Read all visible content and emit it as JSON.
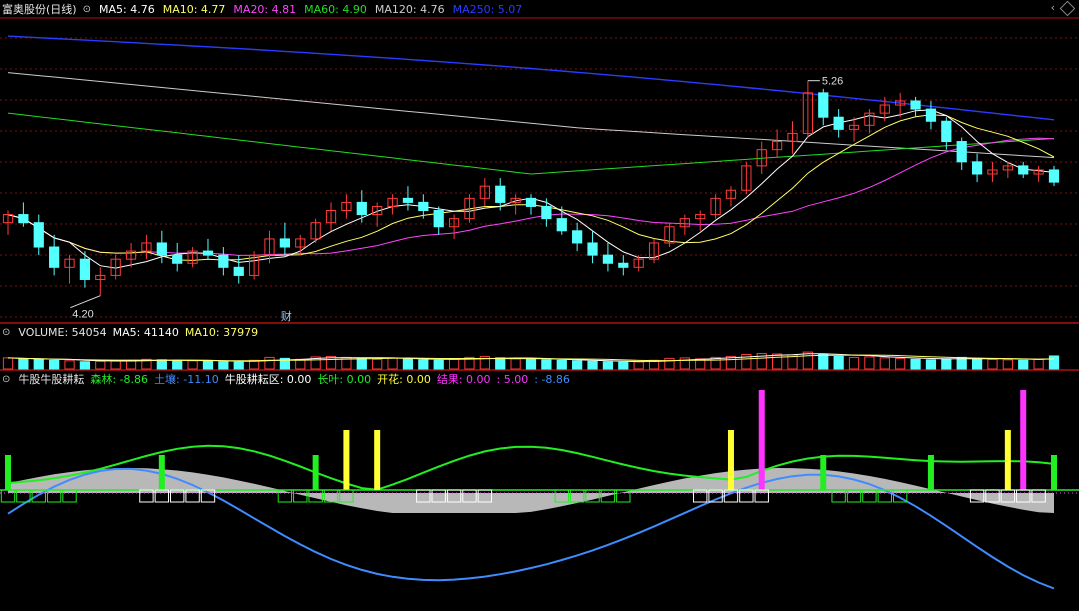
{
  "colors": {
    "bg": "#000000",
    "grid": "#7a1414",
    "divider": "#b01010",
    "up": "#ff3b3b",
    "down": "#54ffff",
    "ma5": "#ffffff",
    "ma10": "#ffff66",
    "ma20": "#ff44ff",
    "ma60": "#22dd22",
    "ma120": "#cccccc",
    "ma250": "#2a3cff",
    "senlin": "#22ee22",
    "turang": "#3f8cff",
    "niugu": "#ffffff",
    "changye": "#22ee22",
    "kaihua": "#ffff33",
    "jieguo": "#ff33ff",
    "val_blue": "#3f8cff"
  },
  "main": {
    "title": "富奥股份(日线)",
    "ma": [
      {
        "label": "MA5: 4.76",
        "color": "#ffffff"
      },
      {
        "label": "MA10: 4.77",
        "color": "#ffff66"
      },
      {
        "label": "MA20: 4.81",
        "color": "#ff44ff"
      },
      {
        "label": "MA60: 4.90",
        "color": "#22dd22"
      },
      {
        "label": "MA120: 4.76",
        "color": "#cccccc"
      },
      {
        "label": "MA250: 5.07",
        "color": "#2a3cff"
      }
    ],
    "high_label": "5.26",
    "low_label": "4.20",
    "event_label": "财"
  },
  "volume": {
    "title": "VOLUME: 54054",
    "ma5": "MA5: 41140",
    "ma10": "MA10: 37979"
  },
  "indicator": {
    "title": "牛股牛股耕耘",
    "items": [
      {
        "label": "森林: -8.86",
        "color": "#22ee22"
      },
      {
        "label": "土壤: -11.10",
        "color": "#3f8cff"
      },
      {
        "label": "牛股耕耘区: 0.00",
        "color": "#ffffff"
      },
      {
        "label": "长叶: 0.00",
        "color": "#22ee22"
      },
      {
        "label": "开花: 0.00",
        "color": "#ffff33"
      },
      {
        "label": "结果: 0.00",
        "color": "#ff33ff"
      },
      {
        "label": ": 5.00",
        "color": "#ff33ff"
      },
      {
        "label": ": -8.86",
        "color": "#3f8cff"
      }
    ]
  },
  "chart_data": {
    "type": "candlestick",
    "ylim_price": [
      4.1,
      5.5
    ],
    "candles": [
      [
        4.56,
        4.62,
        4.5,
        4.6
      ],
      [
        4.6,
        4.66,
        4.54,
        4.56
      ],
      [
        4.56,
        4.6,
        4.4,
        4.44
      ],
      [
        4.44,
        4.5,
        4.3,
        4.34
      ],
      [
        4.34,
        4.4,
        4.26,
        4.38
      ],
      [
        4.38,
        4.42,
        4.24,
        4.28
      ],
      [
        4.28,
        4.34,
        4.2,
        4.3
      ],
      [
        4.3,
        4.4,
        4.28,
        4.38
      ],
      [
        4.38,
        4.46,
        4.34,
        4.42
      ],
      [
        4.42,
        4.5,
        4.38,
        4.46
      ],
      [
        4.46,
        4.52,
        4.36,
        4.4
      ],
      [
        4.4,
        4.46,
        4.32,
        4.36
      ],
      [
        4.36,
        4.44,
        4.34,
        4.42
      ],
      [
        4.42,
        4.48,
        4.38,
        4.4
      ],
      [
        4.4,
        4.44,
        4.3,
        4.34
      ],
      [
        4.34,
        4.4,
        4.26,
        4.3
      ],
      [
        4.3,
        4.42,
        4.28,
        4.4
      ],
      [
        4.4,
        4.52,
        4.36,
        4.48
      ],
      [
        4.48,
        4.56,
        4.4,
        4.44
      ],
      [
        4.44,
        4.5,
        4.4,
        4.48
      ],
      [
        4.48,
        4.58,
        4.46,
        4.56
      ],
      [
        4.56,
        4.66,
        4.52,
        4.62
      ],
      [
        4.62,
        4.7,
        4.58,
        4.66
      ],
      [
        4.66,
        4.72,
        4.56,
        4.6
      ],
      [
        4.6,
        4.66,
        4.54,
        4.64
      ],
      [
        4.64,
        4.7,
        4.6,
        4.68
      ],
      [
        4.68,
        4.74,
        4.62,
        4.66
      ],
      [
        4.66,
        4.7,
        4.58,
        4.62
      ],
      [
        4.62,
        4.64,
        4.5,
        4.54
      ],
      [
        4.54,
        4.6,
        4.48,
        4.58
      ],
      [
        4.58,
        4.7,
        4.56,
        4.68
      ],
      [
        4.68,
        4.78,
        4.64,
        4.74
      ],
      [
        4.74,
        4.78,
        4.62,
        4.66
      ],
      [
        4.66,
        4.7,
        4.6,
        4.68
      ],
      [
        4.68,
        4.7,
        4.6,
        4.64
      ],
      [
        4.64,
        4.68,
        4.54,
        4.58
      ],
      [
        4.58,
        4.64,
        4.5,
        4.52
      ],
      [
        4.52,
        4.56,
        4.42,
        4.46
      ],
      [
        4.46,
        4.52,
        4.36,
        4.4
      ],
      [
        4.4,
        4.46,
        4.32,
        4.36
      ],
      [
        4.36,
        4.4,
        4.3,
        4.34
      ],
      [
        4.34,
        4.4,
        4.32,
        4.38
      ],
      [
        4.38,
        4.48,
        4.36,
        4.46
      ],
      [
        4.46,
        4.56,
        4.44,
        4.54
      ],
      [
        4.54,
        4.6,
        4.5,
        4.58
      ],
      [
        4.58,
        4.62,
        4.52,
        4.6
      ],
      [
        4.6,
        4.7,
        4.58,
        4.68
      ],
      [
        4.68,
        4.74,
        4.64,
        4.72
      ],
      [
        4.72,
        4.86,
        4.7,
        4.84
      ],
      [
        4.84,
        4.96,
        4.8,
        4.92
      ],
      [
        4.92,
        5.02,
        4.88,
        4.96
      ],
      [
        4.96,
        5.06,
        4.9,
        5.0
      ],
      [
        5.0,
        5.26,
        4.98,
        5.2
      ],
      [
        5.2,
        5.22,
        5.04,
        5.08
      ],
      [
        5.08,
        5.12,
        4.98,
        5.02
      ],
      [
        5.02,
        5.08,
        4.96,
        5.04
      ],
      [
        5.04,
        5.12,
        5.0,
        5.1
      ],
      [
        5.1,
        5.18,
        5.06,
        5.14
      ],
      [
        5.14,
        5.2,
        5.08,
        5.16
      ],
      [
        5.16,
        5.18,
        5.08,
        5.12
      ],
      [
        5.12,
        5.16,
        5.02,
        5.06
      ],
      [
        5.06,
        5.08,
        4.92,
        4.96
      ],
      [
        4.96,
        4.98,
        4.82,
        4.86
      ],
      [
        4.86,
        4.9,
        4.76,
        4.8
      ],
      [
        4.8,
        4.86,
        4.76,
        4.82
      ],
      [
        4.82,
        4.86,
        4.78,
        4.84
      ],
      [
        4.84,
        4.86,
        4.78,
        4.8
      ],
      [
        4.8,
        4.84,
        4.76,
        4.82
      ],
      [
        4.82,
        4.84,
        4.74,
        4.76
      ]
    ],
    "volumes": [
      46,
      42,
      40,
      36,
      34,
      30,
      32,
      34,
      36,
      40,
      38,
      36,
      34,
      32,
      30,
      28,
      36,
      48,
      44,
      40,
      50,
      52,
      48,
      44,
      40,
      46,
      42,
      38,
      36,
      40,
      48,
      52,
      46,
      42,
      40,
      38,
      36,
      34,
      32,
      30,
      28,
      30,
      36,
      44,
      46,
      42,
      48,
      52,
      60,
      64,
      62,
      58,
      70,
      60,
      52,
      48,
      50,
      46,
      44,
      40,
      38,
      42,
      48,
      44,
      40,
      38,
      36,
      40,
      54
    ],
    "volume_ylim": [
      0,
      120
    ]
  }
}
